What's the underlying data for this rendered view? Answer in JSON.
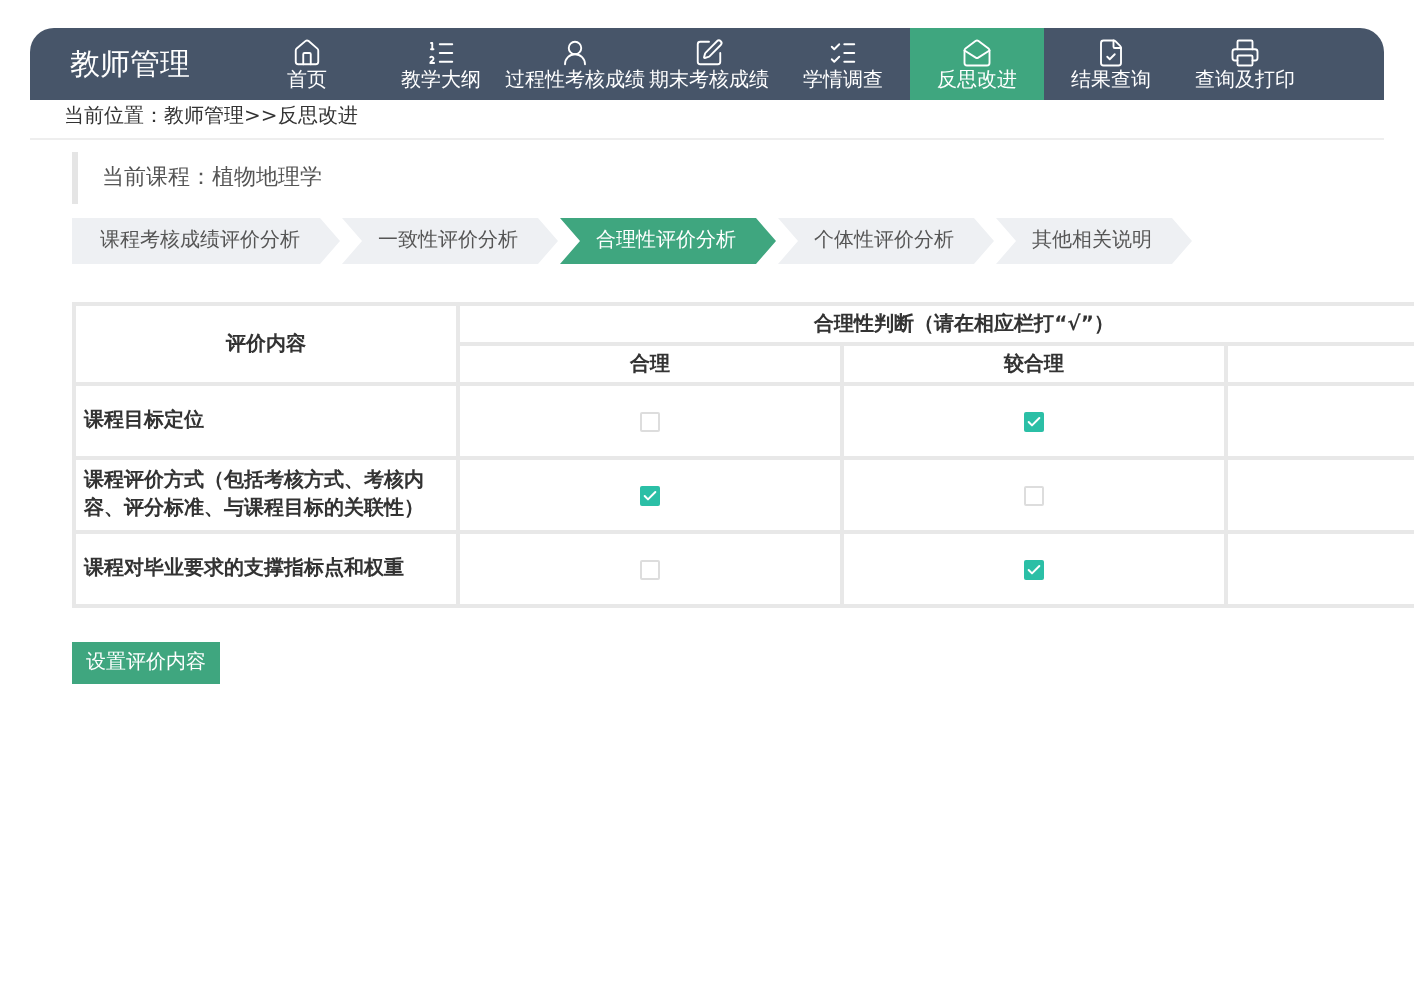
{
  "header": {
    "title": "教师管理",
    "nav": [
      {
        "label": "首页",
        "selected": false
      },
      {
        "label": "教学大纲",
        "selected": false
      },
      {
        "label": "过程性考核成绩",
        "selected": false
      },
      {
        "label": "期末考核成绩",
        "selected": false
      },
      {
        "label": "学情调查",
        "selected": false
      },
      {
        "label": "反思改进",
        "selected": true
      },
      {
        "label": "结果查询",
        "selected": false
      },
      {
        "label": "查询及打印",
        "selected": false
      }
    ]
  },
  "breadcrumb": "当前位置：教师管理>>反思改进",
  "course": "当前课程：植物地理学",
  "steps": [
    {
      "label": "课程考核成绩评价分析",
      "selected": false
    },
    {
      "label": "一致性评价分析",
      "selected": false
    },
    {
      "label": "合理性评价分析",
      "selected": true
    },
    {
      "label": "个体性评价分析",
      "selected": false
    },
    {
      "label": "其他相关说明",
      "selected": false
    }
  ],
  "table": {
    "column_1": "评价内容",
    "group_heading": "合理性判断（请在相应栏打“√”）",
    "subcolumns": [
      "合理",
      "较合理"
    ],
    "rows": [
      {
        "content": "课程目标定位",
        "checks": [
          false,
          true
        ]
      },
      {
        "content": "课程评价方式（包括考核方式、考核内容、评分标准、与课程目标的关联性）",
        "checks": [
          true,
          false
        ]
      },
      {
        "content": "课程对毕业要求的支撑指标点和权重",
        "checks": [
          false,
          true
        ]
      }
    ]
  },
  "button": "设置评价内容"
}
